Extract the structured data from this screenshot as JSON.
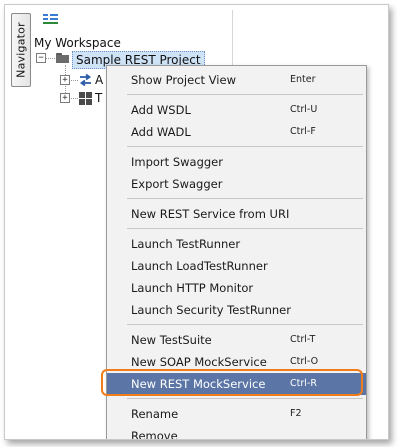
{
  "navigator": {
    "tab_label": "Navigator"
  },
  "tree": {
    "workspace_label": "My Workspace",
    "project_label": "Sample REST Project",
    "children": [
      {
        "label": "A",
        "icon": "swap-arrows-icon"
      },
      {
        "label": "T",
        "icon": "grid-icon"
      }
    ]
  },
  "context_menu": {
    "items": [
      {
        "label": "Show Project View",
        "shortcut": "Enter"
      },
      {
        "label": "Add WSDL",
        "shortcut": "Ctrl-U"
      },
      {
        "label": "Add WADL",
        "shortcut": "Ctrl-F"
      },
      {
        "label": "Import Swagger",
        "shortcut": ""
      },
      {
        "label": "Export Swagger",
        "shortcut": ""
      },
      {
        "label": "New REST Service from URI",
        "shortcut": ""
      },
      {
        "label": "Launch TestRunner",
        "shortcut": ""
      },
      {
        "label": "Launch LoadTestRunner",
        "shortcut": ""
      },
      {
        "label": "Launch HTTP Monitor",
        "shortcut": ""
      },
      {
        "label": "Launch Security TestRunner",
        "shortcut": ""
      },
      {
        "label": "New TestSuite",
        "shortcut": "Ctrl-T"
      },
      {
        "label": "New SOAP MockService",
        "shortcut": "Ctrl-O"
      },
      {
        "label": "New REST MockService",
        "shortcut": "Ctrl-R"
      },
      {
        "label": "Rename",
        "shortcut": "F2"
      },
      {
        "label": "Remove",
        "shortcut": ""
      }
    ],
    "selected_index": 12
  },
  "colors": {
    "selection": "#5b76a6",
    "highlight_outline": "#f07d1a",
    "tree_selection": "#cfe3f7"
  }
}
